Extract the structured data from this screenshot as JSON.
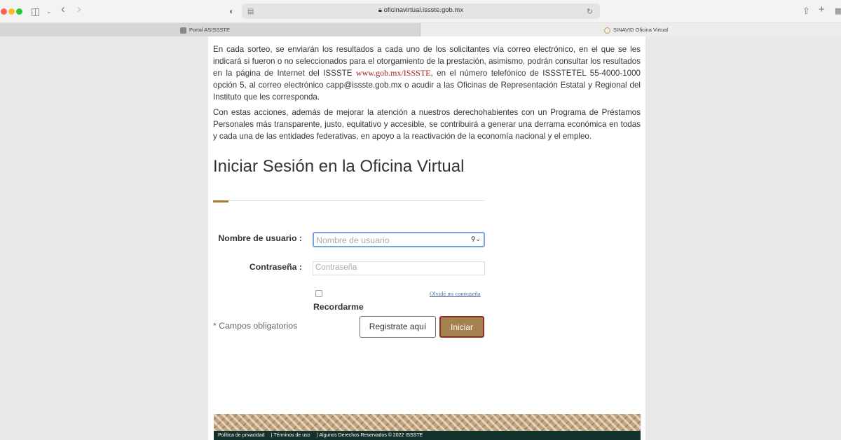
{
  "browser": {
    "url": "oficinavirtual.issste.gob.mx",
    "tabs": [
      {
        "label": "Portal ASISSSTE"
      },
      {
        "label": "SINAVID Oficina Virtual"
      }
    ]
  },
  "content": {
    "paragraph1_a": "En cada sorteo, se enviarán los resultados a cada uno de los solicitantes vía correo electrónico, en el que se les indicará si fueron o no seleccionados para el otorgamiento de la prestación, asimismo, podrán consultar los resultados en la página de Internet del ISSSTE ",
    "paragraph1_link": "www.gob.mx/ISSSTE",
    "paragraph1_b": ", en el número telefónico de ISSSTETEL 55-4000-1000 opción 5, al correo electrónico capp@issste.gob.mx o acudir a las Oficinas de Representación Estatal y Regional del Instituto que les corresponda.",
    "paragraph2": "Con estas acciones, además de mejorar la atención a nuestros derechohabientes con un Programa de Préstamos Personales más transparente, justo, equitativo y accesible, se contribuirá a generar una derrama económica en todas y cada una de las entidades federativas, en apoyo a la reactivación de la economía nacional y el empleo."
  },
  "login": {
    "title": "Iniciar Sesión en la Oficina Virtual",
    "username_label": "Nombre de usuario :",
    "username_placeholder": "Nombre de usuario",
    "password_label": "Contraseña :",
    "password_placeholder": "Contraseña",
    "forgot_link": "Olvidé mi contraseña",
    "remember_label": "Recordarme",
    "required_note": "* Campos obligatorios",
    "register_button": "Registrate aquí",
    "login_button": "Iniciar"
  },
  "footer": {
    "privacy": "Política de privacidad",
    "terms": "Términos de uso",
    "rights": "Algunos Derechos Reservados © 2022 ISSSTE"
  }
}
